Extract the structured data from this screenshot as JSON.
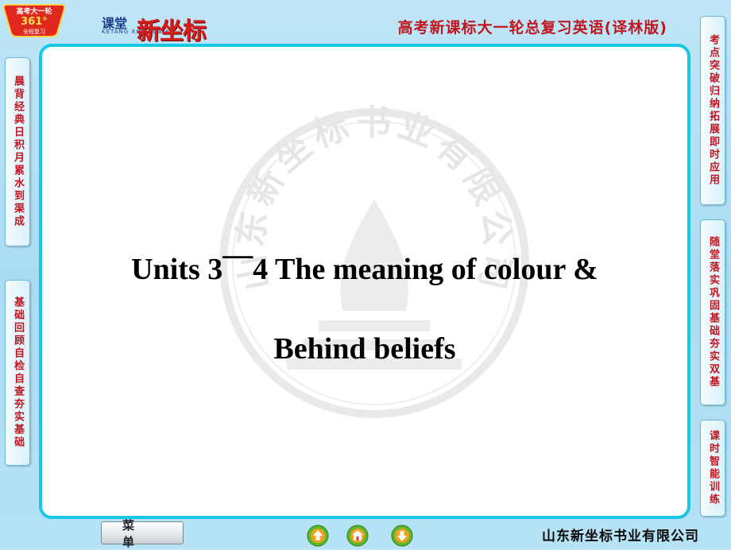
{
  "header": {
    "badge_top": "高考大一轮",
    "badge_number": "361°",
    "badge_bottom": "全程复习",
    "brand_small": "课堂",
    "brand_main": "新坐标",
    "brand_pinyin": "KETANG XINZUOBIAO",
    "title": "高考新课标大一轮总复习英语(译林版)"
  },
  "left_tabs": [
    {
      "label": "晨背经典日积月累水到渠成"
    },
    {
      "label": "基础回顾自检自查夯实基础"
    }
  ],
  "right_tabs": [
    {
      "label": "考点突破归纳拓展即时应用"
    },
    {
      "label": "随堂落实巩固基础夯实双基"
    },
    {
      "label": "课时智能训练"
    }
  ],
  "slide": {
    "title_line1": "Units 3¯¯4    The meaning  of colour &",
    "title_line2": "Behind  beliefs",
    "watermark_text": "山东新坐标书业有限公司"
  },
  "footer": {
    "menu_label": "菜单",
    "nav_buttons": [
      "up-arrow-icon",
      "home-icon",
      "down-arrow-icon"
    ],
    "company": "山东新坐标书业有限公司"
  },
  "colors": {
    "background": "#a9dcf3",
    "accent_red": "#c0161f",
    "frame_cyan": "#18c7e6"
  }
}
